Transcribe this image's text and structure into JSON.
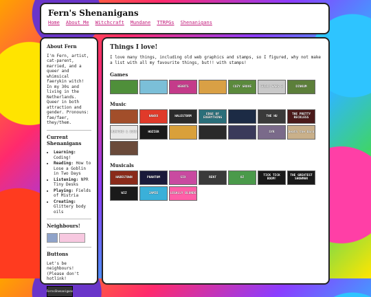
{
  "header": {
    "title": "Fern's Shenanigans",
    "nav": [
      "Home",
      "About Me",
      "Witchcraft",
      "Mundane",
      "TTRPGs",
      "Shenanigans"
    ]
  },
  "sidebar": {
    "about_title": "About Fern",
    "about_text": "I'm Fern, artist, cat-parent, married, and a queer and whimsical faerykin witch! In my 30s and living in the Netherlands. Queer in both attraction and gender. Pronouns: fae/faer, they/them.",
    "shen_title": "Current Shenanigans",
    "shenanigans": [
      {
        "k": "Learning:",
        "v": "Coding!"
      },
      {
        "k": "Reading:",
        "v": "How to Lose a Goblin in Two Days"
      },
      {
        "k": "Listening:",
        "v": "NPR Tiny Desks"
      },
      {
        "k": "Playing:",
        "v": "Fields of Mistria"
      },
      {
        "k": "Creating:",
        "v": "Glittery body oils"
      }
    ],
    "neigh_title": "Neighbours!",
    "buttons_title": "Buttons",
    "buttons_text": "Let's be neighbours! (Please don't hotlink!",
    "button_label": "FernsShenanigans"
  },
  "main": {
    "title": "Things I love!",
    "intro": "I love many things, including old web graphics and stamps, so I figured, why not make a list with all my favourite things, but!! with stamps!",
    "sections": [
      {
        "title": "Games",
        "tiles": [
          {
            "label": "",
            "color": "#4f8f3a"
          },
          {
            "label": "",
            "color": "#7bbfd8"
          },
          {
            "label": "HEARTS",
            "color": "#c43b8a"
          },
          {
            "label": "",
            "color": "#d9a045"
          },
          {
            "label": "COZY GROVE",
            "color": "#5b8a3c"
          },
          {
            "label": "GUILD WARS 2",
            "color": "#c9c9c9"
          },
          {
            "label": "DINKUM",
            "color": "#5c7f3a"
          }
        ]
      },
      {
        "title": "Music",
        "tiles": [
          {
            "label": "",
            "color": "#a24e2a"
          },
          {
            "label": "HAWXX",
            "color": "#e03a2a"
          },
          {
            "label": "HALESTORM",
            "color": "#2a2a2a"
          },
          {
            "label": "EDGE OF EVERYTHING",
            "color": "#2a6f7a"
          },
          {
            "label": "",
            "color": "#1c2b45"
          },
          {
            "label": "THE HU",
            "color": "#3a3a3a"
          },
          {
            "label": "THE PRETTY RECKLESS",
            "color": "#4a1a1a"
          },
          {
            "label": "MUMFORD & SONS",
            "color": "#e9e9e9"
          },
          {
            "label": "HOZIER",
            "color": "#1a1a1a"
          },
          {
            "label": "",
            "color": "#d9a03a"
          },
          {
            "label": "",
            "color": "#2a2a2a"
          },
          {
            "label": "",
            "color": "#3a3a5a"
          },
          {
            "label": "SYR",
            "color": "#7a6a8a"
          },
          {
            "label": "Death the Bard",
            "color": "#c9b08a"
          },
          {
            "label": "",
            "color": "#6a4a3a"
          }
        ]
      },
      {
        "title": "Musicals",
        "tiles": [
          {
            "label": "HADESTOWN",
            "color": "#8a2a1a"
          },
          {
            "label": "PHANTOM",
            "color": "#1a1a3a"
          },
          {
            "label": "SIX",
            "color": "#c94aa0"
          },
          {
            "label": "RENT",
            "color": "#3a3a3a"
          },
          {
            "label": "OZ",
            "color": "#4a9a4a"
          },
          {
            "label": "TICK TICK BOOM!",
            "color": "#1a1a1a"
          },
          {
            "label": "THE GREATEST SHOWMAN",
            "color": "#1a1a1a"
          },
          {
            "label": "WIZ",
            "color": "#1a1a1a"
          },
          {
            "label": "JAMIE",
            "color": "#3ab0d9"
          },
          {
            "label": "LEGALLY BLONDE",
            "color": "#ff5fa8"
          }
        ]
      }
    ]
  }
}
